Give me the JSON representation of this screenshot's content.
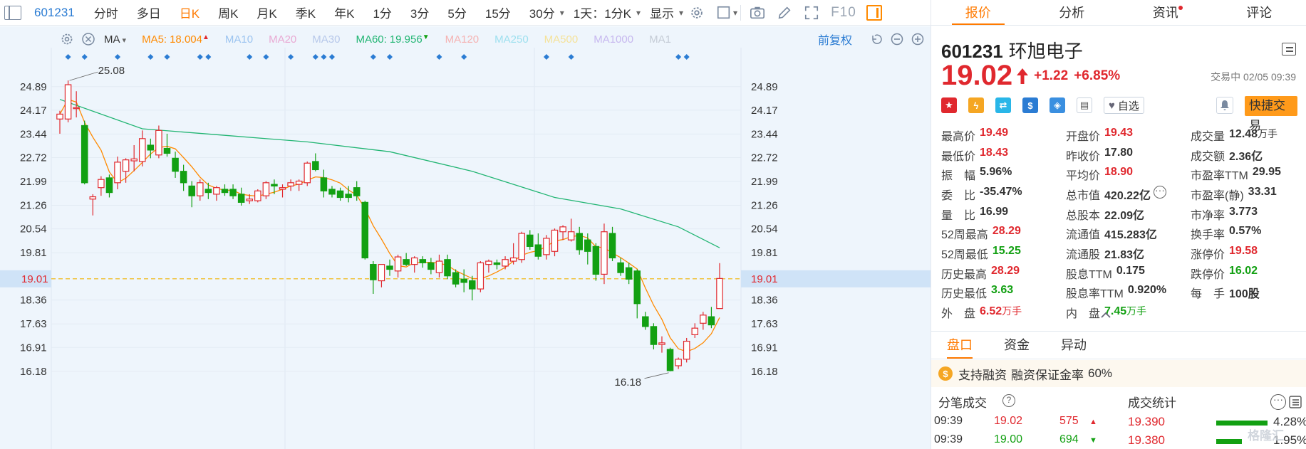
{
  "toolbar": {
    "code": "601231",
    "tabs": [
      "分时",
      "多日",
      "日K",
      "周K",
      "月K",
      "季K",
      "年K",
      "1分",
      "3分",
      "5分",
      "15分",
      "30分"
    ],
    "active_tab": "日K",
    "interval_dropdown": "1天：1分K",
    "display_dropdown": "显示",
    "f10_label": "F10"
  },
  "ma_legend": {
    "selector": "MA",
    "items": [
      {
        "label": "MA5:",
        "value": "18.004",
        "dir": "up",
        "color": "#ff8a00",
        "faded": false
      },
      {
        "label": "MA10",
        "value": "",
        "dir": "",
        "color": "#9cc4f0",
        "faded": true
      },
      {
        "label": "MA20",
        "value": "",
        "dir": "",
        "color": "#e9a9d3",
        "faded": true
      },
      {
        "label": "MA30",
        "value": "",
        "dir": "",
        "color": "#b7c8ea",
        "faded": true
      },
      {
        "label": "MA60:",
        "value": "19.956",
        "dir": "down",
        "color": "#22b573",
        "faded": false
      },
      {
        "label": "MA120",
        "value": "",
        "dir": "",
        "color": "#f5b3b3",
        "faded": true
      },
      {
        "label": "MA250",
        "value": "",
        "dir": "",
        "color": "#9ee0ef",
        "faded": true
      },
      {
        "label": "MA500",
        "value": "",
        "dir": "",
        "color": "#f5e29a",
        "faded": true
      },
      {
        "label": "MA1000",
        "value": "",
        "dir": "",
        "color": "#c7b8ef",
        "faded": true
      },
      {
        "label": "MA1",
        "value": "",
        "dir": "",
        "color": "#c5ccd6",
        "faded": true
      }
    ],
    "restore_label": "前复权"
  },
  "chart_data": {
    "type": "candlestick",
    "symbol": "601231",
    "y_ticks": [
      24.89,
      24.17,
      23.44,
      22.72,
      21.99,
      21.26,
      20.54,
      19.81,
      19.01,
      18.36,
      17.63,
      16.91,
      16.18
    ],
    "y_tick_labels": [
      "24.89",
      "24.17",
      "23.44",
      "22.72",
      "21.99",
      "21.26",
      "20.54",
      "19.81",
      "19.01",
      "18.36",
      "17.63",
      "16.91",
      "16.18"
    ],
    "ylim": [
      15.7,
      25.7
    ],
    "current_price_line": 19.01,
    "current_price_label": "19.01",
    "max_label": "25.08",
    "max_value": 25.08,
    "min_label": "16.18",
    "min_value": 16.18,
    "event_markers": [
      1,
      3,
      7,
      11,
      13,
      17,
      18,
      23,
      25,
      28,
      31,
      32,
      33,
      38,
      40,
      46,
      49,
      59,
      62,
      75,
      76
    ],
    "up_color": "#e0282e",
    "down_color": "#12a012",
    "ma5_color": "#ff8a00",
    "ma60_color": "#22b573",
    "candles": [
      {
        "o": 23.9,
        "h": 24.15,
        "l": 23.45,
        "c": 24.05
      },
      {
        "o": 23.9,
        "h": 25.08,
        "l": 23.8,
        "c": 24.95
      },
      {
        "o": 24.22,
        "h": 24.75,
        "l": 23.95,
        "c": 24.25
      },
      {
        "o": 23.7,
        "h": 23.85,
        "l": 21.9,
        "c": 21.95
      },
      {
        "o": 21.45,
        "h": 21.6,
        "l": 20.95,
        "c": 21.52
      },
      {
        "o": 21.8,
        "h": 22.15,
        "l": 21.55,
        "c": 22.05
      },
      {
        "o": 22.1,
        "h": 22.2,
        "l": 21.5,
        "c": 21.65
      },
      {
        "o": 21.95,
        "h": 22.75,
        "l": 21.75,
        "c": 22.58
      },
      {
        "o": 22.3,
        "h": 22.7,
        "l": 21.95,
        "c": 22.65
      },
      {
        "o": 22.62,
        "h": 23.1,
        "l": 22.3,
        "c": 22.68
      },
      {
        "o": 22.6,
        "h": 23.55,
        "l": 22.45,
        "c": 23.3
      },
      {
        "o": 23.1,
        "h": 23.3,
        "l": 22.7,
        "c": 22.95
      },
      {
        "o": 22.8,
        "h": 23.7,
        "l": 22.7,
        "c": 23.55
      },
      {
        "o": 23.0,
        "h": 23.45,
        "l": 22.75,
        "c": 22.85
      },
      {
        "o": 22.7,
        "h": 22.9,
        "l": 22.1,
        "c": 22.3
      },
      {
        "o": 22.3,
        "h": 22.5,
        "l": 21.7,
        "c": 21.95
      },
      {
        "o": 21.85,
        "h": 22.0,
        "l": 21.2,
        "c": 21.55
      },
      {
        "o": 21.55,
        "h": 22.05,
        "l": 21.4,
        "c": 21.95
      },
      {
        "o": 21.75,
        "h": 21.95,
        "l": 21.45,
        "c": 21.65
      },
      {
        "o": 21.6,
        "h": 21.85,
        "l": 21.4,
        "c": 21.8
      },
      {
        "o": 21.75,
        "h": 21.9,
        "l": 21.55,
        "c": 21.65
      },
      {
        "o": 21.75,
        "h": 21.9,
        "l": 21.45,
        "c": 21.55
      },
      {
        "o": 21.6,
        "h": 21.8,
        "l": 21.25,
        "c": 21.35
      },
      {
        "o": 21.4,
        "h": 21.6,
        "l": 21.3,
        "c": 21.45
      },
      {
        "o": 21.4,
        "h": 21.75,
        "l": 21.35,
        "c": 21.7
      },
      {
        "o": 21.55,
        "h": 22.0,
        "l": 21.45,
        "c": 21.95
      },
      {
        "o": 21.9,
        "h": 22.05,
        "l": 21.6,
        "c": 21.85
      },
      {
        "o": 21.75,
        "h": 21.9,
        "l": 21.5,
        "c": 21.8
      },
      {
        "o": 21.85,
        "h": 22.05,
        "l": 21.7,
        "c": 21.95
      },
      {
        "o": 21.9,
        "h": 22.05,
        "l": 21.7,
        "c": 22.0
      },
      {
        "o": 21.95,
        "h": 22.6,
        "l": 21.85,
        "c": 22.55
      },
      {
        "o": 22.6,
        "h": 22.85,
        "l": 22.3,
        "c": 22.35
      },
      {
        "o": 22.1,
        "h": 22.35,
        "l": 21.5,
        "c": 21.7
      },
      {
        "o": 21.75,
        "h": 21.85,
        "l": 21.5,
        "c": 21.6
      },
      {
        "o": 21.7,
        "h": 21.8,
        "l": 21.4,
        "c": 21.5
      },
      {
        "o": 21.6,
        "h": 21.85,
        "l": 21.35,
        "c": 21.5
      },
      {
        "o": 21.8,
        "h": 22.0,
        "l": 21.4,
        "c": 21.55
      },
      {
        "o": 21.35,
        "h": 21.4,
        "l": 19.6,
        "c": 19.65
      },
      {
        "o": 19.45,
        "h": 19.55,
        "l": 18.55,
        "c": 18.98
      },
      {
        "o": 18.95,
        "h": 19.45,
        "l": 18.75,
        "c": 19.45
      },
      {
        "o": 19.4,
        "h": 19.6,
        "l": 19.1,
        "c": 19.3
      },
      {
        "o": 19.25,
        "h": 19.75,
        "l": 19.05,
        "c": 19.68
      },
      {
        "o": 19.6,
        "h": 19.8,
        "l": 19.4,
        "c": 19.45
      },
      {
        "o": 19.45,
        "h": 19.7,
        "l": 19.2,
        "c": 19.65
      },
      {
        "o": 19.6,
        "h": 19.7,
        "l": 19.35,
        "c": 19.5
      },
      {
        "o": 19.5,
        "h": 19.65,
        "l": 19.15,
        "c": 19.3
      },
      {
        "o": 19.2,
        "h": 19.75,
        "l": 19.05,
        "c": 19.55
      },
      {
        "o": 19.6,
        "h": 19.75,
        "l": 19.0,
        "c": 19.1
      },
      {
        "o": 19.2,
        "h": 19.3,
        "l": 18.75,
        "c": 18.85
      },
      {
        "o": 19.0,
        "h": 19.3,
        "l": 18.6,
        "c": 18.9
      },
      {
        "o": 18.95,
        "h": 19.1,
        "l": 18.35,
        "c": 18.7
      },
      {
        "o": 18.7,
        "h": 19.55,
        "l": 18.6,
        "c": 19.5
      },
      {
        "o": 19.45,
        "h": 19.6,
        "l": 19.2,
        "c": 19.55
      },
      {
        "o": 19.5,
        "h": 19.6,
        "l": 19.3,
        "c": 19.45
      },
      {
        "o": 19.4,
        "h": 19.7,
        "l": 19.3,
        "c": 19.6
      },
      {
        "o": 19.55,
        "h": 20.1,
        "l": 19.45,
        "c": 19.65
      },
      {
        "o": 19.6,
        "h": 20.45,
        "l": 19.5,
        "c": 20.4
      },
      {
        "o": 20.35,
        "h": 20.5,
        "l": 19.9,
        "c": 20.0
      },
      {
        "o": 20.05,
        "h": 20.4,
        "l": 19.6,
        "c": 19.7
      },
      {
        "o": 19.75,
        "h": 20.35,
        "l": 19.6,
        "c": 20.25
      },
      {
        "o": 19.85,
        "h": 20.55,
        "l": 19.7,
        "c": 20.5
      },
      {
        "o": 20.45,
        "h": 20.65,
        "l": 20.2,
        "c": 20.6
      },
      {
        "o": 20.2,
        "h": 20.85,
        "l": 20.15,
        "c": 20.45
      },
      {
        "o": 20.4,
        "h": 20.6,
        "l": 19.75,
        "c": 19.9
      },
      {
        "o": 20.2,
        "h": 20.4,
        "l": 19.45,
        "c": 19.85
      },
      {
        "o": 20.0,
        "h": 20.1,
        "l": 18.95,
        "c": 19.15
      },
      {
        "o": 19.15,
        "h": 20.7,
        "l": 18.85,
        "c": 20.45
      },
      {
        "o": 20.4,
        "h": 20.6,
        "l": 19.55,
        "c": 19.65
      },
      {
        "o": 19.5,
        "h": 19.65,
        "l": 19.1,
        "c": 19.2
      },
      {
        "o": 19.35,
        "h": 19.5,
        "l": 18.85,
        "c": 19.0
      },
      {
        "o": 19.25,
        "h": 19.3,
        "l": 17.8,
        "c": 18.25
      },
      {
        "o": 17.85,
        "h": 18.0,
        "l": 17.45,
        "c": 17.55
      },
      {
        "o": 17.55,
        "h": 17.65,
        "l": 16.85,
        "c": 17.0
      },
      {
        "o": 17.0,
        "h": 17.25,
        "l": 16.75,
        "c": 17.05
      },
      {
        "o": 16.85,
        "h": 16.9,
        "l": 16.18,
        "c": 16.2
      },
      {
        "o": 16.35,
        "h": 16.6,
        "l": 16.25,
        "c": 16.55
      },
      {
        "o": 16.55,
        "h": 17.2,
        "l": 16.45,
        "c": 17.1
      },
      {
        "o": 17.3,
        "h": 17.65,
        "l": 17.2,
        "c": 17.5
      },
      {
        "o": 17.65,
        "h": 18.0,
        "l": 17.45,
        "c": 17.9
      },
      {
        "o": 17.85,
        "h": 18.15,
        "l": 17.5,
        "c": 17.6
      },
      {
        "o": 18.1,
        "h": 19.49,
        "l": 18.43,
        "c": 19.02
      }
    ]
  },
  "panel": {
    "tabs": [
      "报价",
      "分析",
      "资讯",
      "评论"
    ],
    "active_tab": "报价",
    "code": "601231",
    "name": "环旭电子",
    "price": "19.02",
    "change": "+1.22",
    "change_pct": "+6.85%",
    "trade_status": "交易中 02/05 09:39",
    "favorite_label": "自选",
    "quick_trade_label": "快捷交易",
    "stats": [
      [
        {
          "l": "最高价",
          "v": "19.49",
          "c": "red"
        },
        {
          "l": "开盘价",
          "v": "19.43",
          "c": "red"
        },
        {
          "l": "成交量",
          "v": "12.48",
          "u": "万手",
          "c": ""
        }
      ],
      [
        {
          "l": "最低价",
          "v": "18.43",
          "c": "red"
        },
        {
          "l": "昨收价",
          "v": "17.80",
          "c": ""
        },
        {
          "l": "成交额",
          "v": "2.36亿",
          "c": ""
        }
      ],
      [
        {
          "l": "振　幅",
          "v": "5.96%",
          "c": ""
        },
        {
          "l": "平均价",
          "v": "18.90",
          "c": "red"
        },
        {
          "l": "市盈率TTM",
          "v": "29.95",
          "c": ""
        }
      ],
      [
        {
          "l": "委　比",
          "v": "-35.47%",
          "c": ""
        },
        {
          "l": "总市值",
          "v": "420.22亿",
          "c": ""
        },
        {
          "l": "市盈率(静)",
          "v": "33.31",
          "c": ""
        }
      ],
      [
        {
          "l": "量　比",
          "v": "16.99",
          "c": ""
        },
        {
          "l": "总股本",
          "v": "22.09亿",
          "c": ""
        },
        {
          "l": "市净率",
          "v": "3.773",
          "c": ""
        }
      ],
      [
        {
          "l": "52周最高",
          "v": "28.29",
          "c": "red"
        },
        {
          "l": "流通值",
          "v": "415.283亿",
          "c": ""
        },
        {
          "l": "换手率",
          "v": "0.57%",
          "c": ""
        }
      ],
      [
        {
          "l": "52周最低",
          "v": "15.25",
          "c": "green"
        },
        {
          "l": "流通股",
          "v": "21.83亿",
          "c": ""
        },
        {
          "l": "涨停价",
          "v": "19.58",
          "c": "red"
        }
      ],
      [
        {
          "l": "历史最高",
          "v": "28.29",
          "c": "red"
        },
        {
          "l": "股息TTM",
          "v": "0.175",
          "c": ""
        },
        {
          "l": "跌停价",
          "v": "16.02",
          "c": "green"
        }
      ],
      [
        {
          "l": "历史最低",
          "v": "3.63",
          "c": "green"
        },
        {
          "l": "股息率TTM",
          "v": "0.920%",
          "c": ""
        },
        {
          "l": "每　手",
          "v": "100股",
          "c": ""
        }
      ],
      [
        {
          "l": "外　盘",
          "v": "6.52",
          "u": "万手",
          "c": "red"
        },
        {
          "l": "内　盘",
          "v": "7.45",
          "u": "万手",
          "c": "green"
        },
        {
          "l": "",
          "v": "",
          "c": ""
        }
      ]
    ],
    "sub_tabs": [
      "盘口",
      "资金",
      "异动"
    ],
    "active_sub_tab": "盘口",
    "margin_label": "支持融资",
    "margin_ratio_label": "融资保证金率",
    "margin_ratio_value": "60%",
    "tick_title": "分笔成交",
    "deal_stats_title": "成交统计",
    "ticks": [
      {
        "time": "09:39",
        "price": "19.02",
        "vol": "575",
        "dir": "up"
      },
      {
        "time": "09:39",
        "price": "19.00",
        "vol": "694",
        "dir": "down"
      }
    ],
    "deal_stats": [
      {
        "price": "19.390",
        "pct": "4.28%",
        "ratio": 0.9
      },
      {
        "price": "19.380",
        "pct": "1.95%",
        "ratio": 0.45
      }
    ],
    "watermark": "格隆汇"
  }
}
